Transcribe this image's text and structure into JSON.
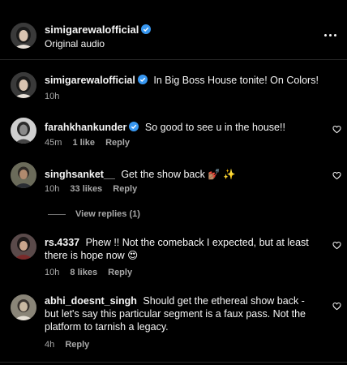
{
  "header": {
    "username": "simigarewalofficial",
    "subtitle": "Original audio",
    "more_icon": "more-horizontal-icon"
  },
  "caption": {
    "username": "simigarewalofficial",
    "text": "In Big Boss House tonite! On Colors!",
    "time": "10h"
  },
  "comments": [
    {
      "username": "farahkhankunder",
      "text": "So good to see u in the house!!",
      "time": "45m",
      "likes": "1 like",
      "reply": "Reply"
    },
    {
      "username": "singhsanket__",
      "text": "Get the show back 💅🏽 ✨",
      "time": "10h",
      "likes": "33 likes",
      "reply": "Reply",
      "view_replies": "View replies (1)"
    },
    {
      "username": "rs.4337",
      "text": "Phew !! Not the comeback I expected, but at least there is hope now 😍",
      "time": "10h",
      "likes": "8 likes",
      "reply": "Reply"
    },
    {
      "username": "abhi_doesnt_singh",
      "text": "Should get the ethereal show back - but let's say this particular segment is a faux pass. Not the platform to tarnish a legacy.",
      "time": "4h",
      "reply": "Reply"
    }
  ],
  "colors": {
    "background": "#000000",
    "text": "#f5f5f5",
    "secondary": "#a8a8a8",
    "verified": "#3897f0"
  }
}
